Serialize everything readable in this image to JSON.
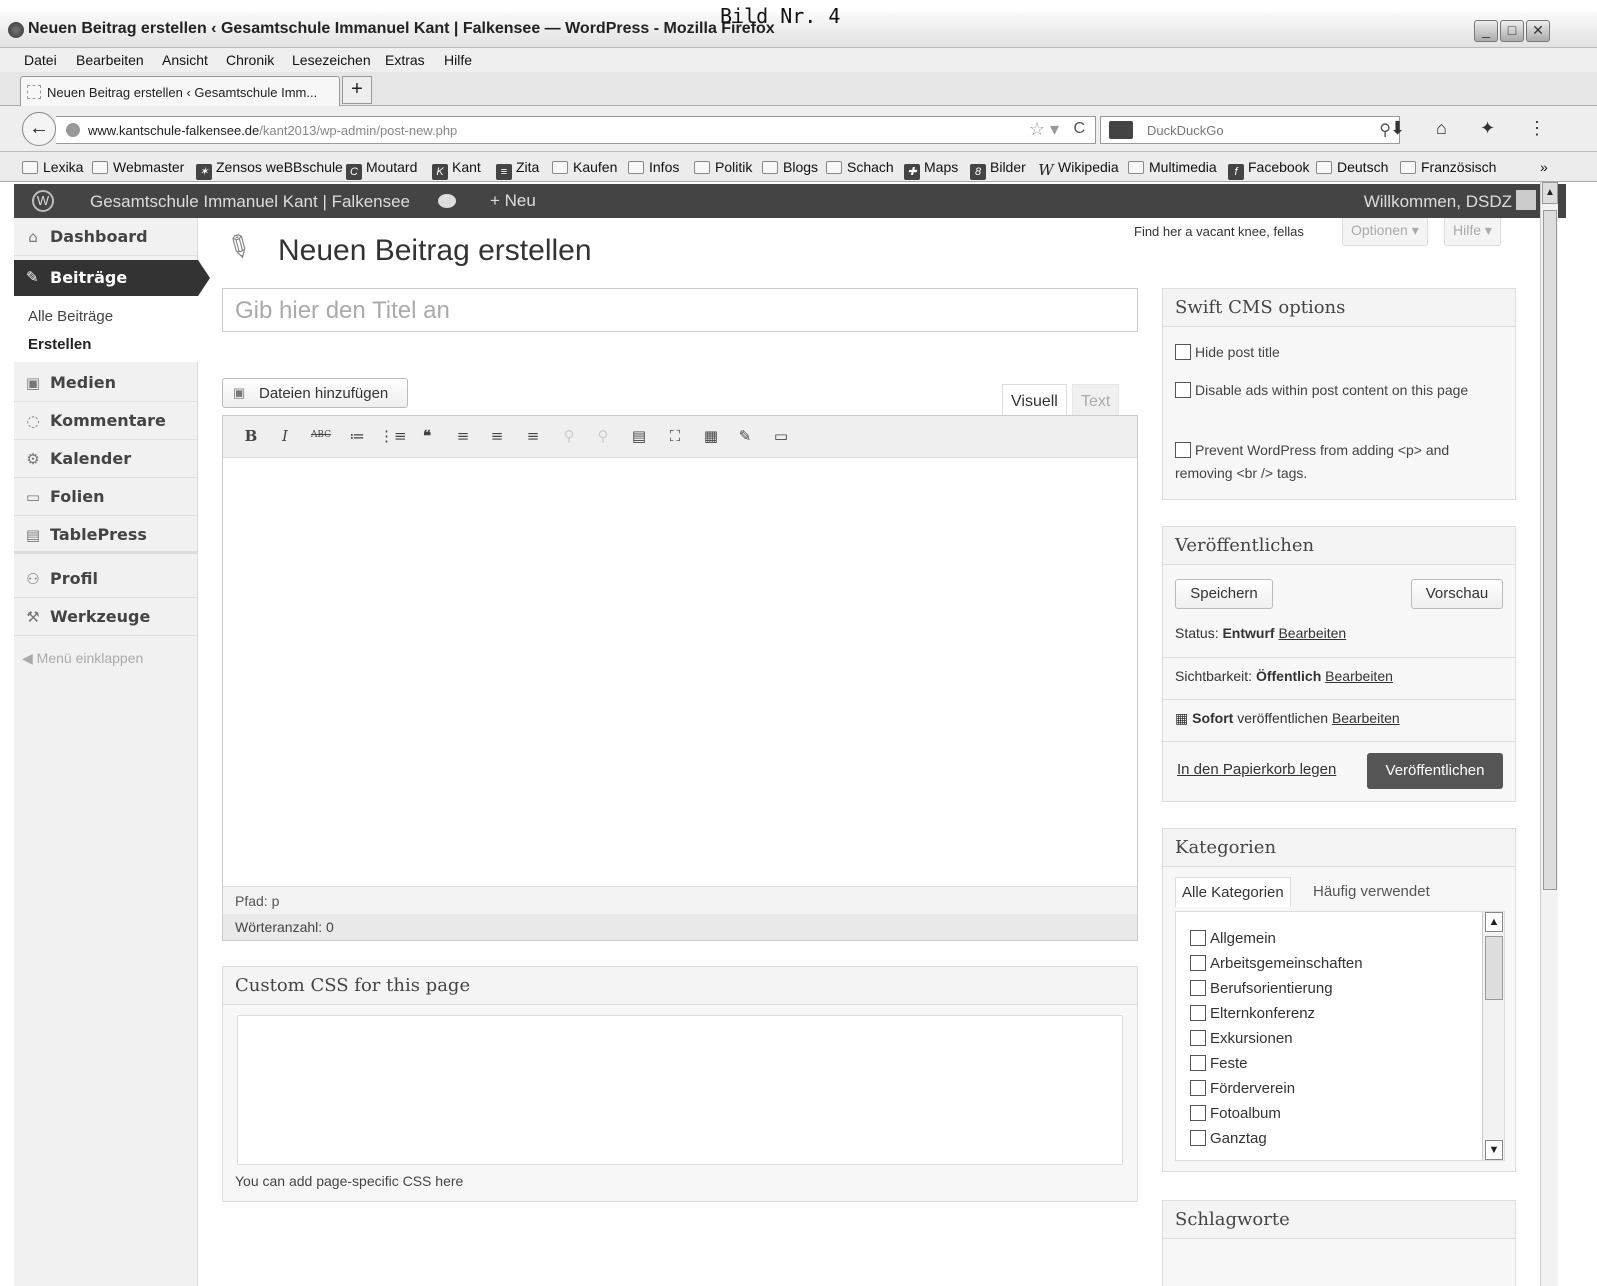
{
  "overlay_label": "Bild Nr. 4",
  "window": {
    "title": "Neuen Beitrag erstellen ‹ Gesamtschule Immanuel Kant | Falkensee — WordPress - Mozilla Firefox",
    "controls": [
      "_",
      "□",
      "✕"
    ]
  },
  "menubar": [
    "Datei",
    "Bearbeiten",
    "Ansicht",
    "Chronik",
    "Lesezeichen",
    "Extras",
    "Hilfe"
  ],
  "tab": {
    "title": "Neuen Beitrag erstellen ‹ Gesamtschule Imm...",
    "new_tab": "+"
  },
  "navbar": {
    "back": "←",
    "url_domain": "www.kantschule-falkensee.de",
    "url_path": "/kant2013/wp-admin/post-new.php",
    "url_prefix": "www.",
    "search_placeholder": "DuckDuckGo"
  },
  "bookmarks": [
    {
      "label": "Lexika",
      "icon": "folder"
    },
    {
      "label": "Webmaster",
      "icon": "folder"
    },
    {
      "label": "Zensos weBBschule",
      "icon": "site"
    },
    {
      "label": "Moutard",
      "icon": "site"
    },
    {
      "label": "Kant",
      "icon": "site"
    },
    {
      "label": "Zita",
      "icon": "site"
    },
    {
      "label": "Kaufen",
      "icon": "folder"
    },
    {
      "label": "Infos",
      "icon": "folder"
    },
    {
      "label": "Politik",
      "icon": "folder"
    },
    {
      "label": "Blogs",
      "icon": "folder"
    },
    {
      "label": "Schach",
      "icon": "folder"
    },
    {
      "label": "Maps",
      "icon": "site"
    },
    {
      "label": "Bilder",
      "icon": "site"
    },
    {
      "label": "Wikipedia",
      "icon": "site"
    },
    {
      "label": "Multimedia",
      "icon": "folder"
    },
    {
      "label": "Facebook",
      "icon": "site"
    },
    {
      "label": "Deutsch",
      "icon": "folder"
    },
    {
      "label": "Französisch",
      "icon": "folder"
    }
  ],
  "bookmarks_more": "»",
  "adminbar": {
    "site_name": "Gesamtschule Immanuel Kant | Falkensee",
    "new_label": "+ Neu",
    "welcome": "Willkommen, DSDZ"
  },
  "sidebar": {
    "dashboard": "Dashboard",
    "beitraege": "Beiträge",
    "sub_all": "Alle Beiträge",
    "sub_new": "Erstellen",
    "medien": "Medien",
    "kommentare": "Kommentare",
    "kalender": "Kalender",
    "folien": "Folien",
    "tablepress": "TablePress",
    "profil": "Profil",
    "werkzeuge": "Werkzeuge",
    "collapse": "Menü einklappen"
  },
  "main": {
    "page_title": "Neuen Beitrag erstellen",
    "topright_text": "Find her a vacant knee, fellas",
    "options_tab": "Optionen ▾",
    "help_tab": "Hilfe ▾",
    "title_placeholder": "Gib hier den Titel an",
    "add_media": "Dateien hinzufügen",
    "tab_visual": "Visuell",
    "tab_text": "Text",
    "path": "Pfad: p",
    "wordcount": "Wörteranzahl: 0"
  },
  "toolbar_buttons": [
    "B",
    "I",
    "ABC",
    "≔",
    "⋮≡",
    "❝",
    "≡",
    "≡",
    "≡",
    "⚲",
    "⚲",
    "▤",
    "⛶",
    "▦",
    "✎",
    "▭"
  ],
  "css_box": {
    "title": "Custom CSS for this page",
    "hint": "You can add page-specific CSS here"
  },
  "swift": {
    "title": "Swift CMS options",
    "opt1": "Hide post title",
    "opt2": "Disable ads within post content on this page",
    "opt3": "Prevent WordPress from adding <p> and removing <br /> tags."
  },
  "publish": {
    "title": "Veröffentlichen",
    "save": "Speichern",
    "preview": "Vorschau",
    "status_label": "Status: ",
    "status_value": "Entwurf",
    "edit": "Bearbeiten",
    "visibility_label": "Sichtbarkeit: ",
    "visibility_value": "Öffentlich",
    "schedule_value": "Sofort",
    "schedule_label": " veröffentlichen ",
    "trash": "In den Papierkorb legen",
    "publish_btn": "Veröffentlichen"
  },
  "categories": {
    "title": "Kategorien",
    "tab_all": "Alle Kategorien",
    "tab_popular": "Häufig verwendet",
    "items": [
      "Allgemein",
      "Arbeitsgemeinschaften",
      "Berufsorientierung",
      "Elternkonferenz",
      "Exkursionen",
      "Feste",
      "Förderverein",
      "Fotoalbum",
      "Ganztag"
    ]
  },
  "tags": {
    "title": "Schlagworte"
  }
}
